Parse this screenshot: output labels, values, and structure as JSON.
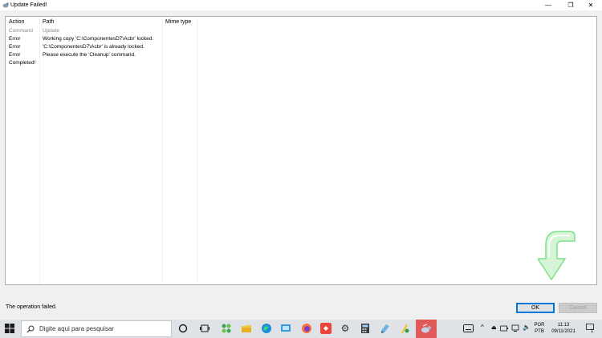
{
  "window": {
    "title": "Update Failed!",
    "minimize_glyph": "—",
    "maximize_glyph": "❐",
    "close_glyph": "✕"
  },
  "list": {
    "columns": [
      "Action",
      "Path",
      "Mime type"
    ],
    "rows": [
      {
        "action": "Command",
        "path": "Update",
        "kind": "command"
      },
      {
        "action": "Error",
        "path": "Working copy 'C:\\ComponentesD7\\Acbr' locked.",
        "kind": "error"
      },
      {
        "action": "Error",
        "path": "'C:\\ComponentesD7\\Acbr' is already locked.",
        "kind": "error"
      },
      {
        "action": "Error",
        "path": "Please execute the 'Cleanup' command.",
        "kind": "error"
      },
      {
        "action": "Completed!",
        "path": "",
        "kind": "completed"
      }
    ]
  },
  "footer": {
    "status": "The operation failed.",
    "ok_label": "OK",
    "cancel_label": "Cancel"
  },
  "taskbar": {
    "search_placeholder": "Digite aqui para pesquisar",
    "language_top": "POR",
    "language_bottom": "PTB",
    "time": "11:13",
    "date": "09/11/2021",
    "notification_count": "1",
    "icons": [
      "task-view-icon",
      "widgets-icon",
      "explorer-icon",
      "edge-icon",
      "mail-icon",
      "firefox-icon",
      "anydesk-icon",
      "settings-icon",
      "calculator-icon",
      "app-icon",
      "paint-icon",
      "tortoise-svn-icon"
    ]
  },
  "colors": {
    "accent": "#0078d7",
    "arrow_green": "#7ee08a",
    "active_task": "#e05a5a"
  }
}
